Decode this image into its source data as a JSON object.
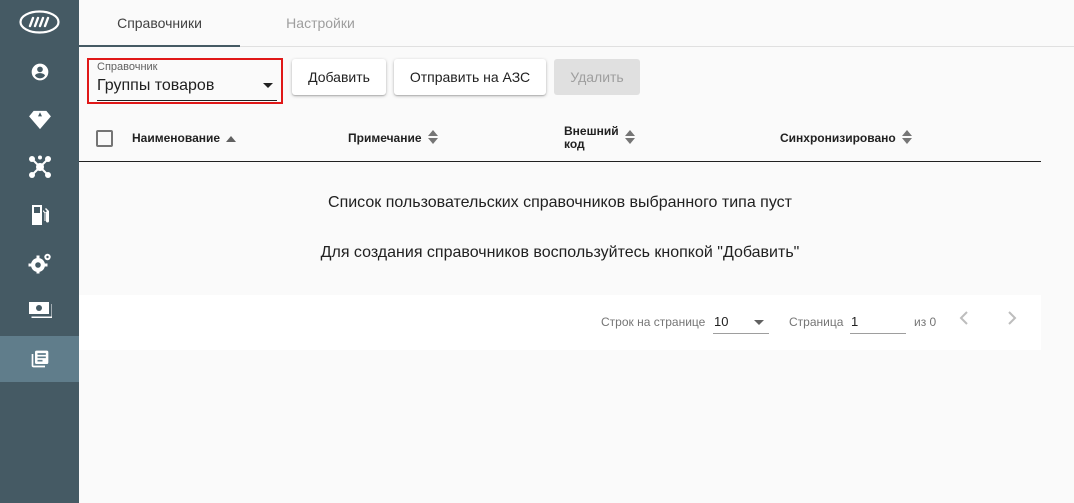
{
  "sidebar": {
    "logo": "brand-logo",
    "items": [
      {
        "icon": "account-icon"
      },
      {
        "icon": "diamond-icon"
      },
      {
        "icon": "network-icon"
      },
      {
        "icon": "gas-station-icon"
      },
      {
        "icon": "settings-icon"
      },
      {
        "icon": "cash-icon"
      },
      {
        "icon": "library-books-icon",
        "active": true
      }
    ],
    "colors": {
      "background": "#455a64",
      "active": "#607d8b"
    }
  },
  "tabs": [
    {
      "label": "Справочники",
      "active": true
    },
    {
      "label": "Настройки",
      "active": false
    }
  ],
  "directory_select": {
    "label": "Справочник",
    "value": "Группы товаров"
  },
  "toolbar": {
    "add_label": "Добавить",
    "send_label": "Отправить на АЗС",
    "delete_label": "Удалить"
  },
  "table": {
    "columns": [
      {
        "label": "Наименование",
        "sort": "asc"
      },
      {
        "label": "Примечание",
        "sort": "none"
      },
      {
        "label_line1": "Внешний",
        "label_line2": "код",
        "sort": "none"
      },
      {
        "label": "Синхронизировано",
        "sort": "none"
      }
    ]
  },
  "empty_state": {
    "line1": "Список пользовательских справочников выбранного типа пуст",
    "line2": "Для создания справочников воспользуйтесь кнопкой \"Добавить\""
  },
  "paginator": {
    "rows_label": "Строк на странице",
    "rows_value": "10",
    "page_label": "Страница",
    "page_value": "1",
    "of_label": "из 0"
  },
  "highlight_color": "#e01818"
}
